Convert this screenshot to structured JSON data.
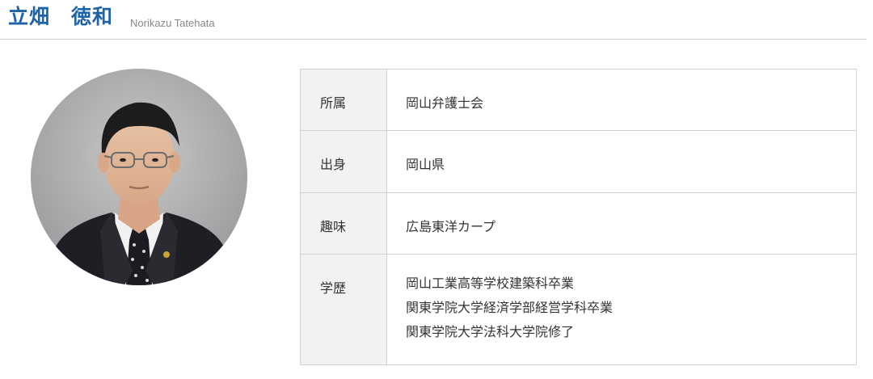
{
  "header": {
    "name_jp": "立畑　徳和",
    "name_en": "Norikazu Tatehata"
  },
  "profile": {
    "rows": [
      {
        "label": "所属",
        "value": "岡山弁護士会"
      },
      {
        "label": "出身",
        "value": "岡山県"
      },
      {
        "label": "趣味",
        "value": "広島東洋カープ"
      },
      {
        "label": "学歴",
        "values": [
          "岡山工業高等学校建築科卒業",
          "関東学院大学経済学部経営学科卒業",
          "関東学院大学法科大学院修了"
        ]
      }
    ]
  }
}
